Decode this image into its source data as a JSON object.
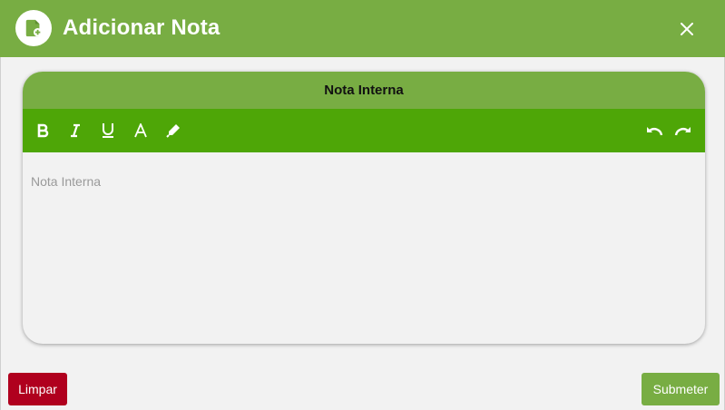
{
  "dialog": {
    "title": "Adicionar Nota",
    "icon": "note-add-icon",
    "close_icon": "close-icon"
  },
  "editor": {
    "header": "Nota Interna",
    "placeholder": "Nota Interna",
    "toolbar": {
      "left": [
        "bold-icon",
        "italic-icon",
        "underline-icon",
        "text-color-icon",
        "highlight-icon"
      ],
      "right": [
        "undo-icon",
        "redo-icon"
      ]
    }
  },
  "buttons": {
    "clear": "Limpar",
    "submit": "Submeter"
  },
  "colors": {
    "header_green": "#78ad43",
    "toolbar_green": "#4ea607",
    "clear_red": "#b0001e",
    "background": "#f2f2f2"
  }
}
